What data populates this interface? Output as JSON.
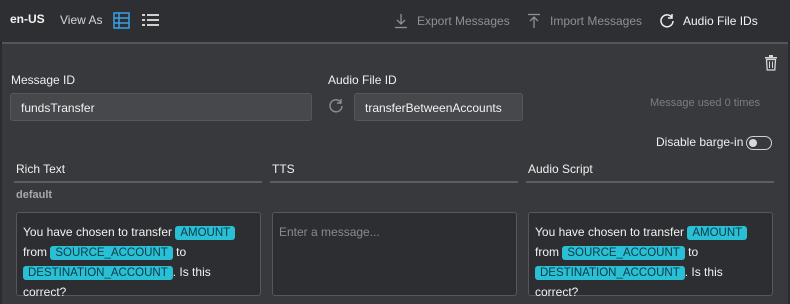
{
  "toolbar": {
    "locale": "en-US",
    "view_as_label": "View As",
    "export_label": "Export Messages",
    "import_label": "Import Messages",
    "audio_ids_label": "Audio File IDs"
  },
  "form": {
    "message_id_label": "Message ID",
    "message_id_value": "fundsTransfer",
    "audio_file_id_label": "Audio File ID",
    "audio_file_id_value": "transferBetweenAccounts",
    "usage_text": "Message used 0 times",
    "barge_in_label": "Disable barge-in",
    "barge_in_enabled": false
  },
  "columns": {
    "rich_text": "Rich Text",
    "tts": "TTS",
    "audio_script": "Audio Script"
  },
  "default_label": "default",
  "rich_text_content": {
    "part1": "You have chosen to transfer",
    "tag1": "AMOUNT",
    "part2": "from",
    "tag2": "SOURCE_ACCOUNT",
    "part3": "to",
    "tag3": "DESTINATION_ACCOUNT",
    "part4": ". Is this correct?"
  },
  "tts_placeholder": "Enter a message...",
  "audio_script_content": {
    "part1": "You have chosen to transfer",
    "tag1": "AMOUNT",
    "part2": "from",
    "tag2": "SOURCE_ACCOUNT",
    "part3": "to",
    "tag3": "DESTINATION_ACCOUNT",
    "part4": ". Is this correct?"
  },
  "colors": {
    "accent": "#29c0d6",
    "background": "#2b2c30",
    "panel": "#38393d"
  }
}
